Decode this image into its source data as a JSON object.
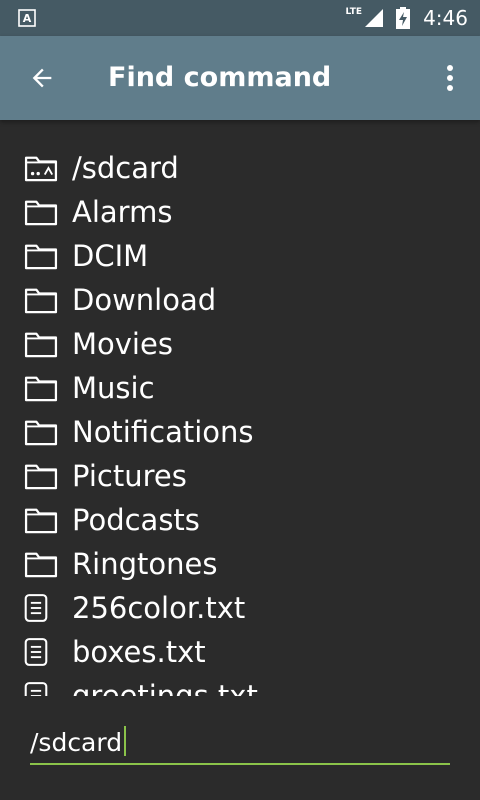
{
  "status_bar": {
    "network": "LTE",
    "time": "4:46"
  },
  "app_bar": {
    "title": "Find command",
    "back_icon": "arrow-back-icon",
    "menu_icon": "more-vert-icon"
  },
  "file_list": [
    {
      "name": "/sdcard",
      "type": "folder-root"
    },
    {
      "name": "Alarms",
      "type": "folder"
    },
    {
      "name": "DCIM",
      "type": "folder"
    },
    {
      "name": "Download",
      "type": "folder"
    },
    {
      "name": "Movies",
      "type": "folder"
    },
    {
      "name": "Music",
      "type": "folder"
    },
    {
      "name": "Notifications",
      "type": "folder"
    },
    {
      "name": "Pictures",
      "type": "folder"
    },
    {
      "name": "Podcasts",
      "type": "folder"
    },
    {
      "name": "Ringtones",
      "type": "folder"
    },
    {
      "name": "256color.txt",
      "type": "file"
    },
    {
      "name": "boxes.txt",
      "type": "file"
    },
    {
      "name": "greetings.txt",
      "type": "file"
    }
  ],
  "path_input": {
    "value": "/sdcard"
  },
  "colors": {
    "status_bar": "#455a64",
    "app_bar": "#607d8b",
    "background": "#2b2b2b",
    "accent": "#8bc34a"
  }
}
